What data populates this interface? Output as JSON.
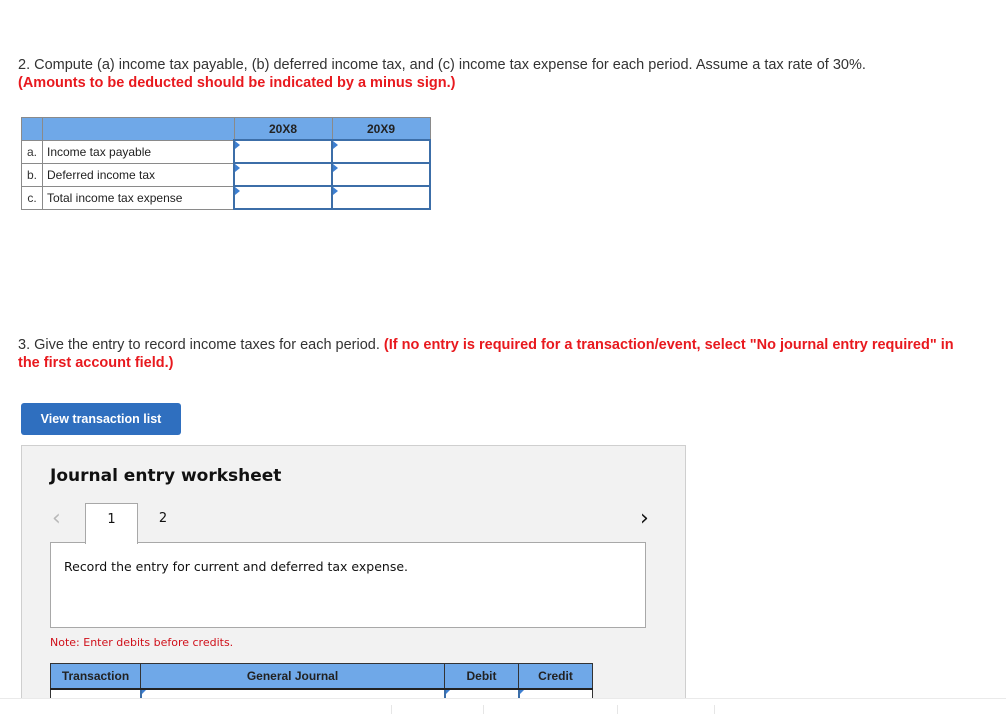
{
  "question2": {
    "text": "2. Compute (a) income tax payable, (b) deferred income tax, and (c) income tax expense for each period. Assume a tax rate of 30%.",
    "note": "(Amounts to be deducted should be indicated by a minus sign.)"
  },
  "tax_table": {
    "headers": [
      "",
      "",
      "20X8",
      "20X9"
    ],
    "rows": [
      {
        "letter": "a.",
        "label": "Income tax payable",
        "values": [
          "",
          ""
        ]
      },
      {
        "letter": "b.",
        "label": "Deferred income tax",
        "values": [
          "",
          ""
        ]
      },
      {
        "letter": "c.",
        "label": "Total income tax expense",
        "values": [
          "",
          ""
        ]
      }
    ]
  },
  "question3": {
    "text": "3. Give the entry to record income taxes for each period.",
    "note": "(If no entry is required for a transaction/event, select \"No journal entry required\" in the first account field.)"
  },
  "view_button": {
    "label": "View transaction list"
  },
  "worksheet": {
    "title": "Journal entry worksheet",
    "prev_icon": "chevron-left-icon",
    "next_icon": "chevron-right-icon",
    "tabs": [
      {
        "label": "1",
        "active": true
      },
      {
        "label": "2",
        "active": false
      }
    ],
    "instruction": "Record the entry for current and deferred tax expense.",
    "note": "Note: Enter debits before credits.",
    "journal_headers": [
      "Transaction",
      "General Journal",
      "Debit",
      "Credit"
    ]
  },
  "colors": {
    "accent_blue": "#2f6fbf",
    "header_blue": "#6fa8e8",
    "warning_red": "#e8191e"
  }
}
